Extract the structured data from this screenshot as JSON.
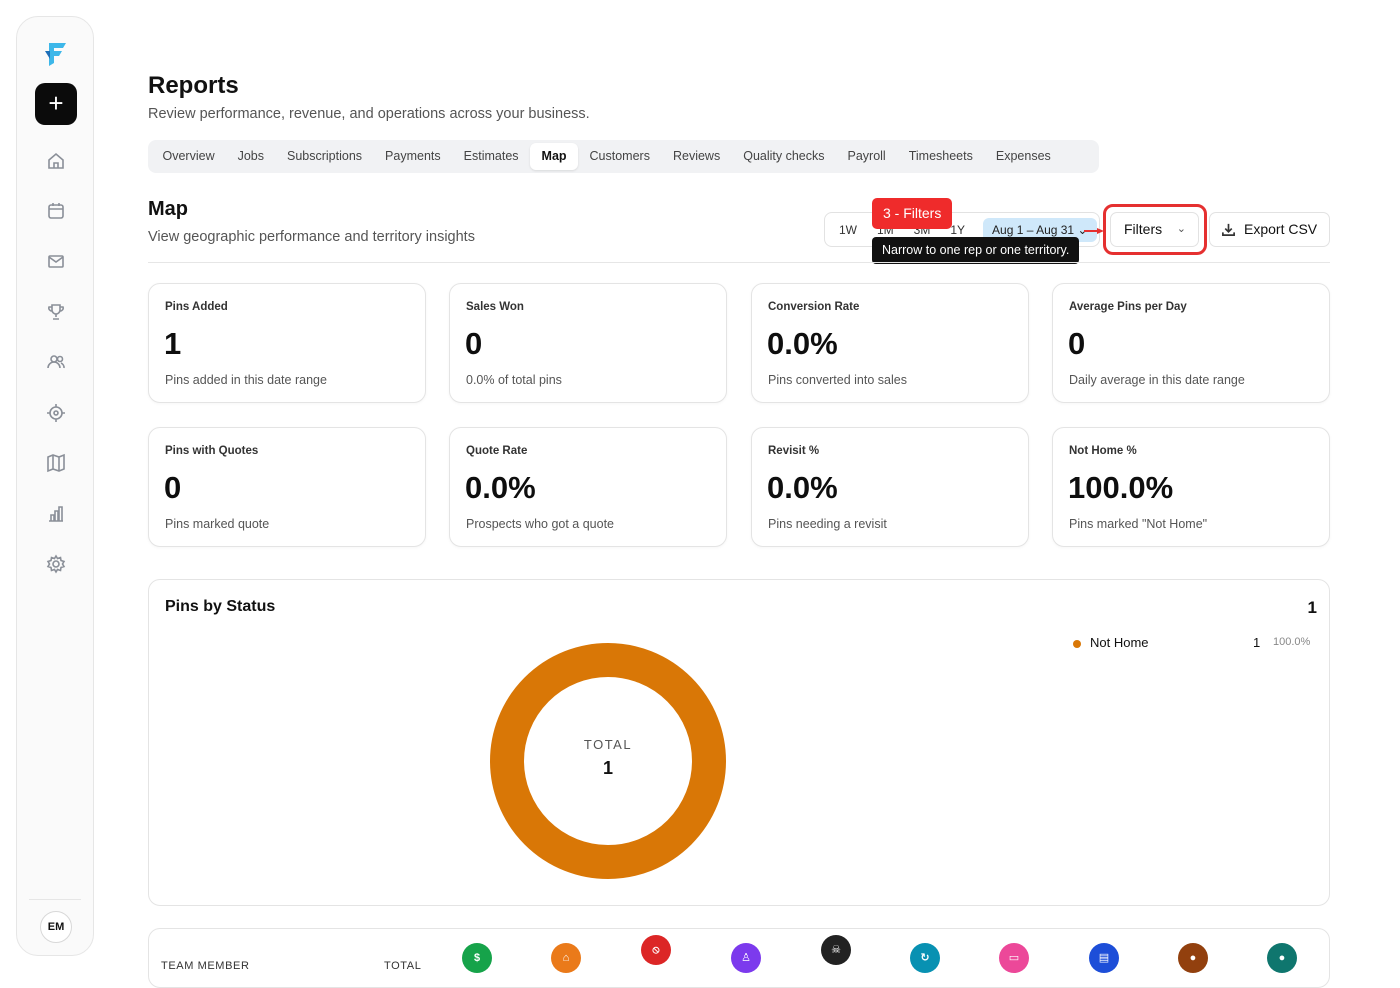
{
  "sidebar": {
    "logo": "F",
    "add_label": "+",
    "nav_icons": [
      "home-icon",
      "calendar-icon",
      "mail-icon",
      "trophy-icon",
      "users-icon",
      "target-icon",
      "map-icon",
      "bar-chart-icon",
      "gear-icon"
    ],
    "avatar": "EM"
  },
  "header": {
    "title": "Reports",
    "subtitle": "Review performance, revenue, and operations across your business."
  },
  "tabs": [
    {
      "label": "Overview"
    },
    {
      "label": "Jobs"
    },
    {
      "label": "Subscriptions"
    },
    {
      "label": "Payments"
    },
    {
      "label": "Estimates"
    },
    {
      "label": "Map",
      "active": true
    },
    {
      "label": "Customers"
    },
    {
      "label": "Reviews"
    },
    {
      "label": "Quality checks"
    },
    {
      "label": "Payroll"
    },
    {
      "label": "Timesheets"
    },
    {
      "label": "Expenses"
    }
  ],
  "section": {
    "title": "Map",
    "subtitle": "View geographic performance and territory insights"
  },
  "toolbar": {
    "ranges": [
      "1W",
      "1M",
      "3M",
      "1Y"
    ],
    "date_range": "Aug 1 – Aug 31",
    "badge": "3 - Filters",
    "tooltip": "Narrow to one rep or one territory.",
    "filters_label": "Filters",
    "export_label": "Export CSV",
    "highlight_color": "#e53030"
  },
  "cards": [
    {
      "label": "Pins Added",
      "value": "1",
      "desc": "Pins added in this date range"
    },
    {
      "label": "Sales Won",
      "value": "0",
      "desc": "0.0% of total pins"
    },
    {
      "label": "Conversion Rate",
      "value": "0.0%",
      "desc": "Pins converted into sales"
    },
    {
      "label": "Average Pins per Day",
      "value": "0",
      "desc": "Daily average in this date range"
    },
    {
      "label": "Pins with Quotes",
      "value": "0",
      "desc": "Pins marked quote"
    },
    {
      "label": "Quote Rate",
      "value": "0.0%",
      "desc": "Prospects who got a quote"
    },
    {
      "label": "Revisit %",
      "value": "0.0%",
      "desc": "Pins needing a revisit"
    },
    {
      "label": "Not Home %",
      "value": "100.0%",
      "desc": "Pins marked \"Not Home\""
    }
  ],
  "pins_by_status": {
    "title": "Pins by Status",
    "count": "1",
    "center_label": "TOTAL",
    "center_value": "1",
    "legend": [
      {
        "name": "Not Home",
        "value": "1",
        "pct": "100.0%",
        "color": "#d97706"
      }
    ]
  },
  "chart_data": {
    "type": "pie",
    "title": "Pins by Status",
    "categories": [
      "Not Home"
    ],
    "values": [
      1
    ],
    "colors": [
      "#d97706"
    ]
  },
  "table": {
    "headers": [
      "TEAM MEMBER",
      "TOTAL"
    ],
    "status_icons": [
      {
        "name": "sale-icon",
        "glyph": "$",
        "color": "#16a34a"
      },
      {
        "name": "home-status-icon",
        "glyph": "⌂",
        "color": "#ea7a1a"
      },
      {
        "name": "no-icon",
        "glyph": "⦸",
        "color": "#dc2626"
      },
      {
        "name": "person-icon",
        "glyph": "♙",
        "color": "#7c3aed"
      },
      {
        "name": "skull-icon",
        "glyph": "☠",
        "color": "#222222"
      },
      {
        "name": "revisit-icon",
        "glyph": "↻",
        "color": "#0891b2"
      },
      {
        "name": "ticket-icon",
        "glyph": "▭",
        "color": "#ec4899"
      },
      {
        "name": "document-icon",
        "glyph": "▤",
        "color": "#1d4ed8"
      },
      {
        "name": "dot-brown-icon",
        "glyph": "●",
        "color": "#92400e"
      },
      {
        "name": "dot-teal-icon",
        "glyph": "●",
        "color": "#0f766e"
      }
    ]
  }
}
